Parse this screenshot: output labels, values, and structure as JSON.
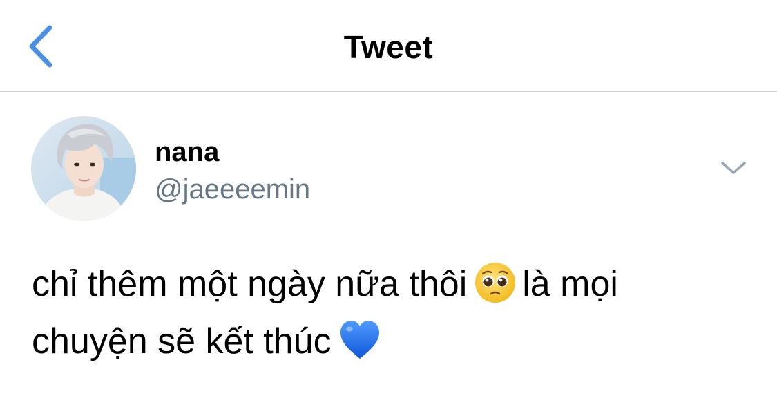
{
  "nav": {
    "back_icon": "chevron-left-icon",
    "title": "Tweet"
  },
  "tweet": {
    "author": {
      "display_name": "nana",
      "handle": "@jaeeeemin",
      "avatar": "avatar-photo"
    },
    "more_icon": "chevron-down-icon",
    "text": {
      "line1_part1": "chỉ thêm một ngày nữa thôi",
      "line1_emoji": "pleading-face-emoji",
      "line1_part2": "là mọi",
      "line2_part1": "chuyện sẽ kết thúc",
      "line2_emoji": "blue-heart-emoji"
    }
  },
  "colors": {
    "accent": "#4a90e2",
    "secondary_text": "#657786",
    "divider": "#d4d4d8",
    "heart": "#1b6fe8",
    "emoji_face": "#f7c52e"
  }
}
